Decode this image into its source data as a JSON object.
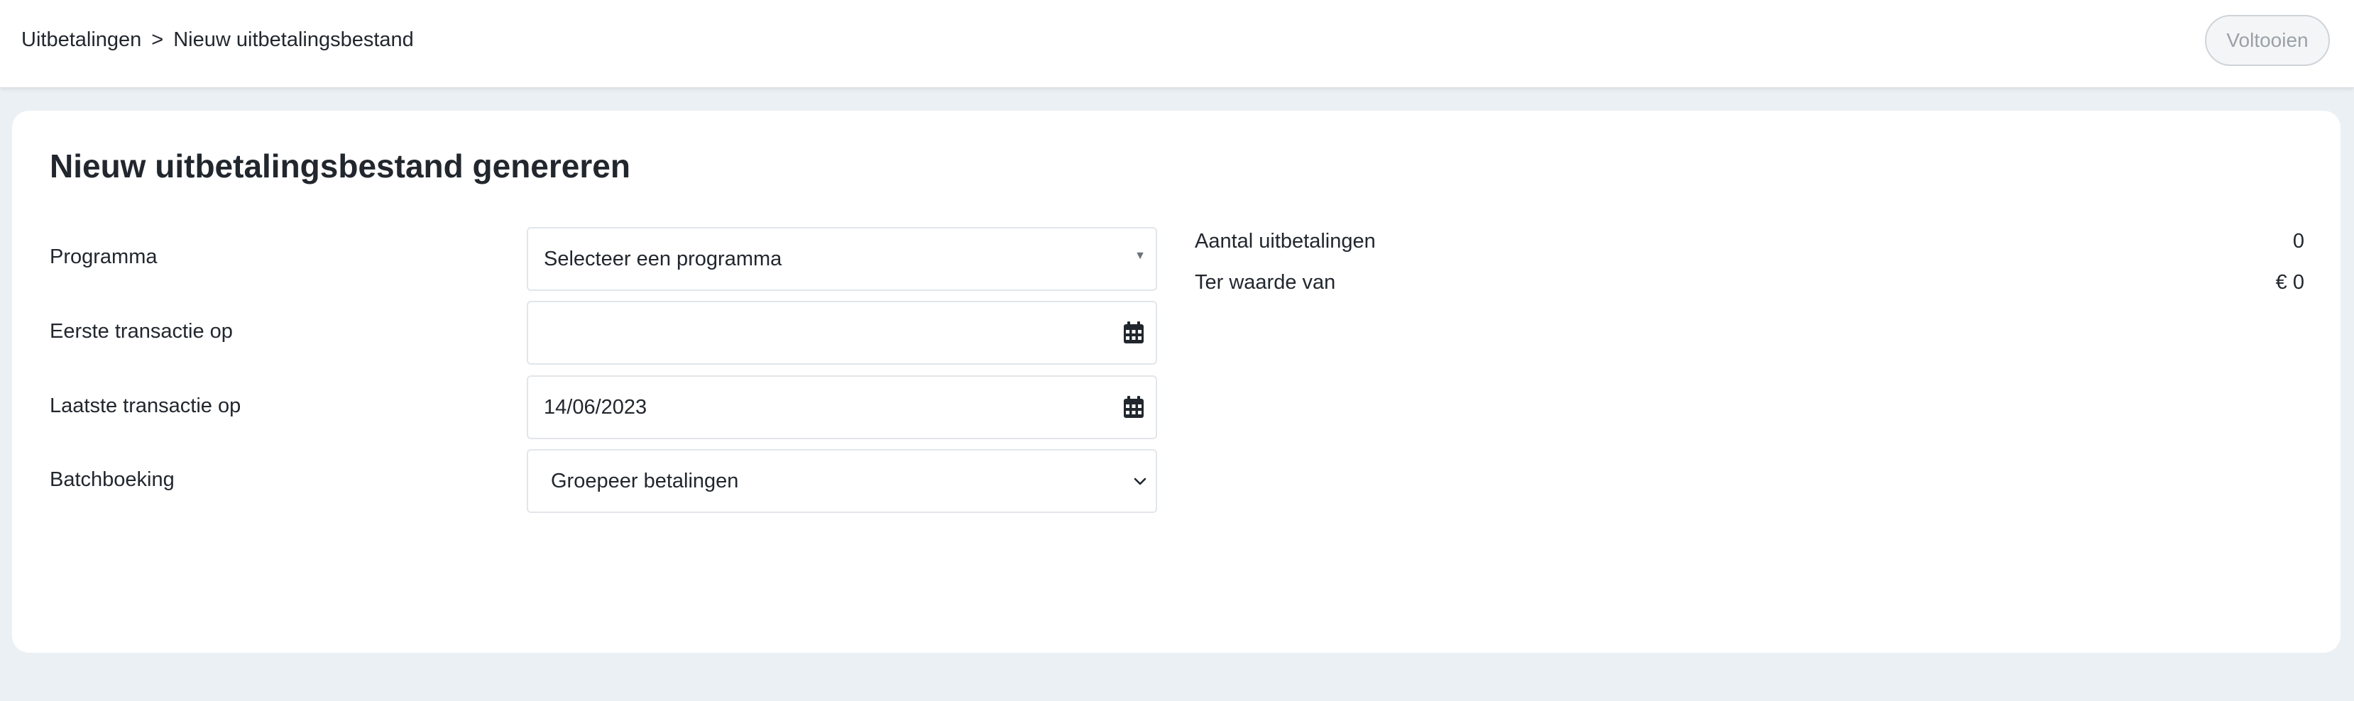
{
  "breadcrumb": {
    "parent": "Uitbetalingen",
    "separator": ">",
    "current": "Nieuw uitbetalingsbestand"
  },
  "header": {
    "finish_label": "Voltooien"
  },
  "page": {
    "title": "Nieuw uitbetalingsbestand genereren"
  },
  "form": {
    "program": {
      "label": "Programma",
      "selected": "Selecteer een programma",
      "icon": "caret-down-icon"
    },
    "first_transaction": {
      "label": "Eerste transactie op",
      "value": "",
      "icon": "calendar-icon"
    },
    "last_transaction": {
      "label": "Laatste transactie op",
      "value": "14/06/2023",
      "icon": "calendar-icon"
    },
    "batch_booking": {
      "label": "Batchboeking",
      "selected": "Groepeer betalingen",
      "icon": "chevron-down-icon"
    }
  },
  "summary": {
    "count_label": "Aantal uitbetalingen",
    "count_value": "0",
    "amount_label": "Ter waarde van",
    "amount_value": "€ 0"
  },
  "colors": {
    "page_background": "#ebf0f4",
    "card_background": "#ffffff",
    "text": "#22272e",
    "disabled_button_text": "#9aa1a8"
  }
}
